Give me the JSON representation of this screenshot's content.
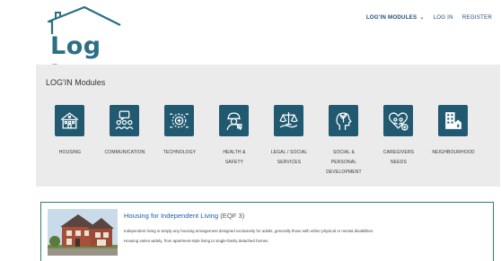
{
  "header": {
    "logo_text": "Log In",
    "nav": {
      "modules_label": "LOG'IN MODULES",
      "login_label": "LOG IN",
      "register_label": "REGISTER"
    }
  },
  "panel": {
    "title": "LOG'IN Modules",
    "tile_color": "#215a70",
    "modules": [
      {
        "line1": "HOUSING",
        "line2": "",
        "line3": "",
        "icon": "house-icon"
      },
      {
        "line1": "COMMUNICATION",
        "line2": "",
        "line3": "",
        "icon": "chat-people-icon"
      },
      {
        "line1": "TECHNOLOGY",
        "line2": "",
        "line3": "",
        "icon": "gear-circuit-icon"
      },
      {
        "line1": "HEALTH &",
        "line2": "SAFETY",
        "line3": "",
        "icon": "worker-helmet-icon"
      },
      {
        "line1": "LEGAL / SOCIAL",
        "line2": "SERVICES",
        "line3": "",
        "icon": "scales-hand-icon"
      },
      {
        "line1": "SOCIAL &",
        "line2": "PERSONAL",
        "line3": "DEVELOPMENT",
        "icon": "head-plant-icon"
      },
      {
        "line1": "CAREGIVERS",
        "line2": "NEEDS",
        "line3": "",
        "icon": "heart-hands-icon"
      },
      {
        "line1": "NEIGHBOURHOOD",
        "line2": "",
        "line3": "",
        "icon": "buildings-icon"
      }
    ]
  },
  "card": {
    "title": "Housing for Independent Living",
    "eqf": "(EQF 3)",
    "desc1": "Independent living is simply any housing arrangement designed exclusively for adults, generally those with either physical or mental disabilities.",
    "desc2": "Housing varies widely, from apartment-style living to single-family detached homes.",
    "accent_color": "#2f7a72"
  }
}
